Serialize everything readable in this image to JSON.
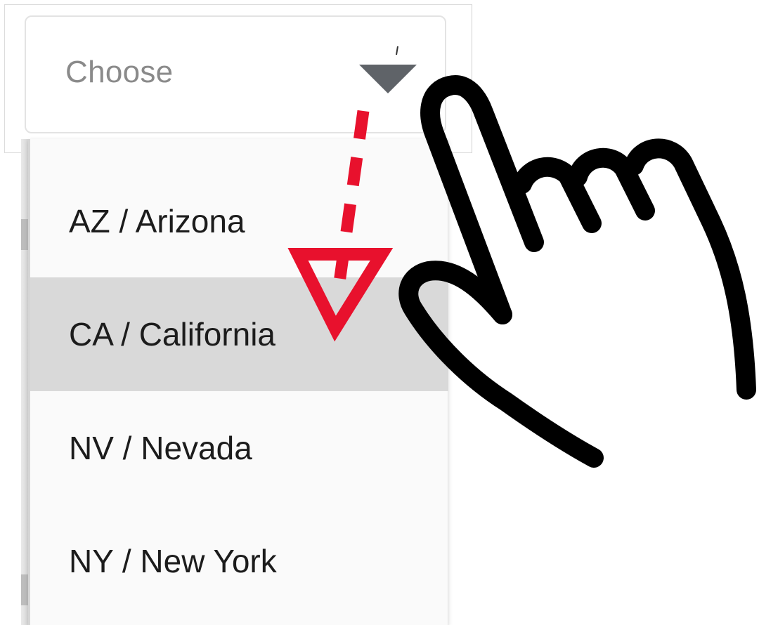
{
  "select": {
    "placeholder": "Choose",
    "caret_icon": "caret-down-icon"
  },
  "dropdown": {
    "options": [
      {
        "label": "AZ / Arizona",
        "highlighted": false
      },
      {
        "label": "CA / California",
        "highlighted": true
      },
      {
        "label": "NV / Nevada",
        "highlighted": false
      },
      {
        "label": "NY / New York",
        "highlighted": false
      }
    ]
  },
  "annotation": {
    "arrow_icon": "dashed-arrow-down-icon",
    "arrow_color": "#e8112d",
    "pointer_icon": "hand-pointer-icon",
    "pointer_color": "#000000"
  },
  "colors": {
    "highlight_bg": "#d9d9d9",
    "caret": "#5f6368",
    "placeholder_text": "#8a8a8a"
  }
}
